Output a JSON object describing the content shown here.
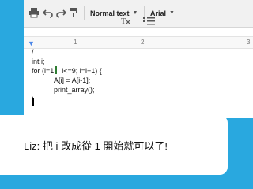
{
  "toolbar": {
    "style_label": "Normal text",
    "font_label": "Arial",
    "icons": [
      "print-icon",
      "undo-icon",
      "redo-icon",
      "paint-format-icon",
      "clear-formatting-icon",
      "numbered-list-icon"
    ]
  },
  "ruler": {
    "tick_1": "1",
    "tick_2": "2",
    "tick_3": "3"
  },
  "code": {
    "lines": [
      "/",
      "int i;",
      "for (i=1",
      "A[i] = A[i-1];",
      "print_array();",
      "}"
    ],
    "line3_rest": "; i<=9; i=i+1) {"
  },
  "caption": {
    "text": "Liz: 把 i 改成從 1 開始就可以了!"
  },
  "colors": {
    "background": "#29a8df",
    "insertion_mark": "#2e7d32"
  }
}
